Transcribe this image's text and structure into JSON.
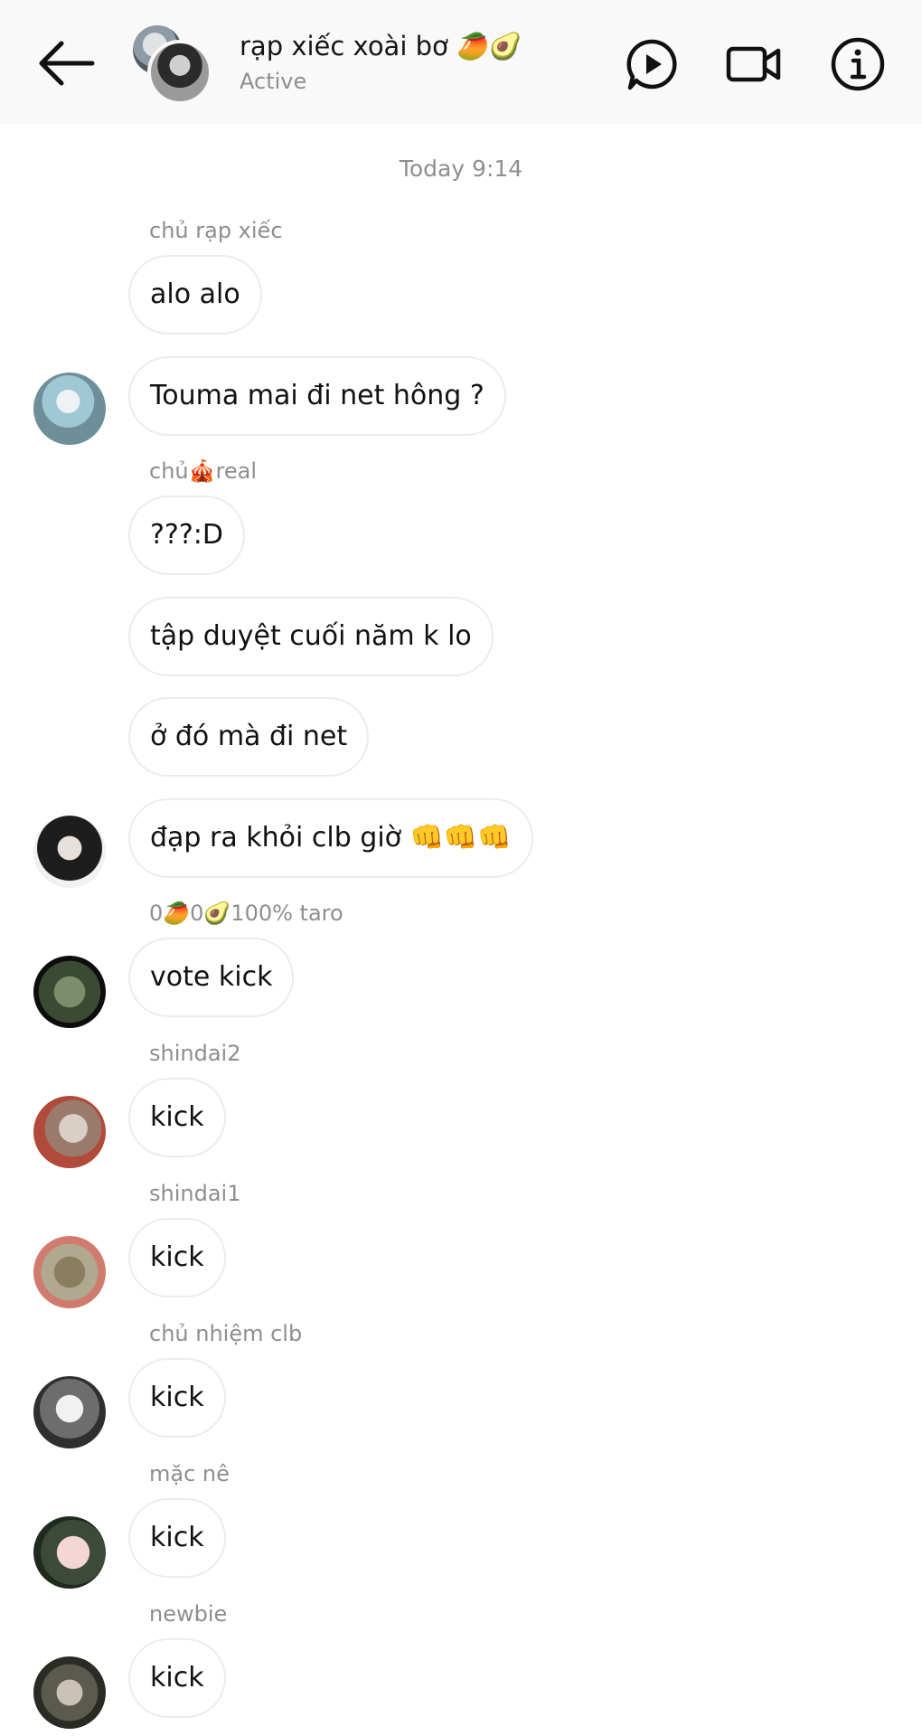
{
  "header": {
    "back_icon": "arrow-left-icon",
    "title": "rạp xiếc xoài bơ 🥭🥑",
    "status": "Active",
    "icons": [
      "video-play-icon",
      "video-camera-icon",
      "info-icon"
    ]
  },
  "timestamp": "Today 9:14",
  "senders": {
    "s1": "chủ rạp xiếc",
    "s2": "chủ🎪real",
    "s3": "0🥭0🥑100% taro",
    "s4": "shindai2",
    "s5": "shindai1",
    "s6": "chủ nhiệm clb",
    "s7": "mặc nê",
    "s8": "newbie"
  },
  "messages": {
    "m1": "alo alo",
    "m2": "Touma mai đi net hông ?",
    "m3": "???:D",
    "m4": "tập duyệt cuối năm k lo",
    "m5": "ở đó mà đi net",
    "m6": "đạp ra khỏi clb giờ 👊👊👊",
    "m7": "vote kick",
    "m8": "kick",
    "m9": "kick",
    "m10": "kick",
    "m11": "kick",
    "m12": "kick"
  }
}
